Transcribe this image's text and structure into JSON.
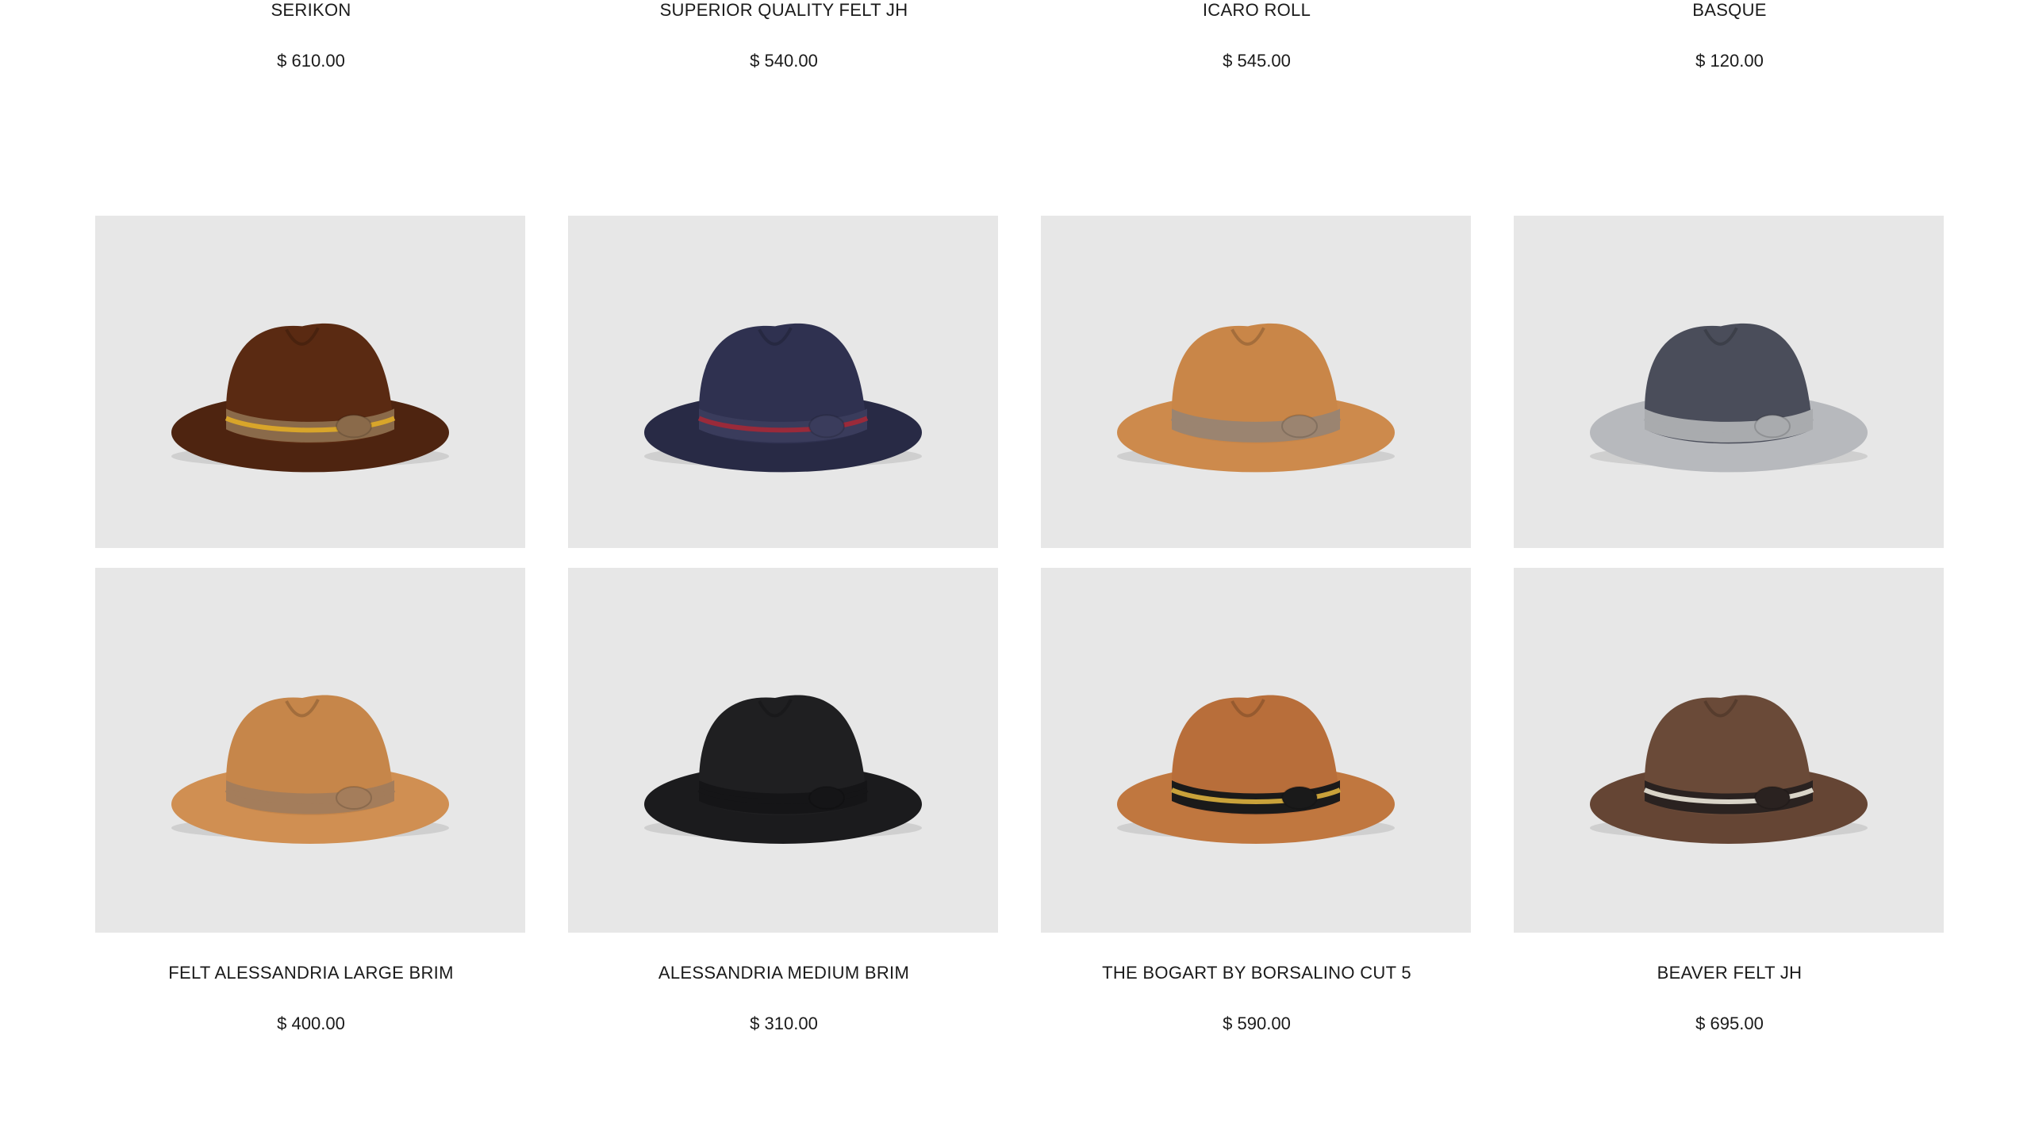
{
  "top_row": [
    {
      "name": "SERIKON",
      "price": "$ 610.00"
    },
    {
      "name": "SUPERIOR QUALITY FELT JH",
      "price": "$ 540.00"
    },
    {
      "name": "ICARO ROLL",
      "price": "$ 545.00"
    },
    {
      "name": "BASQUE",
      "price": "$ 120.00"
    }
  ],
  "row_a": [
    {
      "image": "brown-fedora-yellow-stripe-image",
      "colors": {
        "crown": "#5a2a12",
        "brim": "#4e2410",
        "band": "#8a6a4a",
        "stripe": "#d8a52a"
      }
    },
    {
      "image": "navy-fedora-red-stripe-image",
      "colors": {
        "crown": "#2f3150",
        "brim": "#282a45",
        "band": "#3a3c5c",
        "stripe": "#9a2a3a"
      }
    },
    {
      "image": "tan-fedora-image",
      "colors": {
        "crown": "#c98648",
        "brim": "#cd8a4c",
        "band": "#9b8470",
        "stripe": "#9b8470"
      }
    },
    {
      "image": "charcoal-fedora-grey-brim-image",
      "colors": {
        "crown": "#4a4d5a",
        "brim": "#b7b9bd",
        "band": "#a9abae",
        "stripe": "#a9abae"
      }
    }
  ],
  "row_b": [
    {
      "name": "FELT ALESSANDRIA LARGE BRIM",
      "price": "$ 400.00",
      "image": "camel-fedora-large-brim-image",
      "colors": {
        "crown": "#c6864a",
        "brim": "#d08f52",
        "band": "#a47d5b",
        "stripe": "#a47d5b"
      }
    },
    {
      "name": "ALESSANDRIA MEDIUM BRIM",
      "price": "$ 310.00",
      "image": "black-fedora-image",
      "colors": {
        "crown": "#1f1f21",
        "brim": "#1b1b1d",
        "band": "#151517",
        "stripe": "#151517"
      }
    },
    {
      "name": "THE BOGART BY BORSALINO CUT 5",
      "price": "$ 590.00",
      "image": "rust-fedora-black-embroidered-band-image",
      "colors": {
        "crown": "#b86e3a",
        "brim": "#c0773f",
        "band": "#1a1a1a",
        "stripe": "#c9a23a"
      }
    },
    {
      "name": "BEAVER FELT JH",
      "price": "$ 695.00",
      "image": "brown-fedora-medallion-image",
      "colors": {
        "crown": "#6a4a38",
        "brim": "#654534",
        "band": "#2a2220",
        "stripe": "#d9d4c8"
      }
    }
  ]
}
